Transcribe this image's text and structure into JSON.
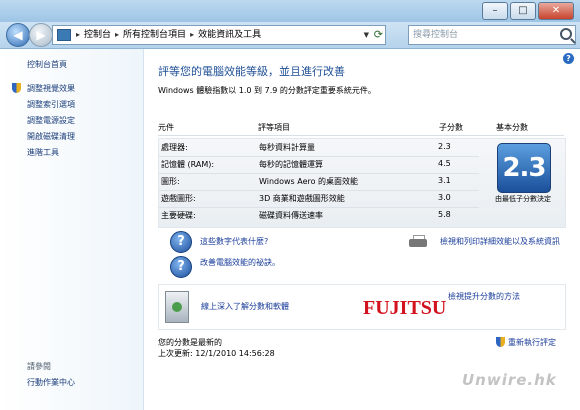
{
  "window": {
    "minimize_glyph": "–",
    "maximize_glyph": "□",
    "close_glyph": "✕"
  },
  "nav": {
    "back_glyph": "◀",
    "forward_glyph": "▶",
    "breadcrumbs": [
      "控制台",
      "所有控制台項目",
      "效能資訊及工具"
    ],
    "search_placeholder": "搜尋控制台"
  },
  "sidebar": {
    "home": "控制台首頁",
    "items": [
      "調整視覺效果",
      "調整索引選項",
      "調整電源設定",
      "開啟磁碟清理",
      "進階工具"
    ],
    "see_also_heading": "請參閱",
    "see_also": [
      "行動作業中心"
    ]
  },
  "main": {
    "title": "評等您的電腦效能等級，並且進行改善",
    "subtitle": "Windows 體驗指數以 1.0 到 7.9 的分數評定重要系統元件。",
    "columns": {
      "component": "元件",
      "rated_item": "評等項目",
      "subscore": "子分數",
      "base_score": "基本分數"
    },
    "rows": [
      {
        "component": "處理器:",
        "item": "每秒資料計算量",
        "score": "2.3"
      },
      {
        "component": "記憶體 (RAM):",
        "item": "每秒的記憶體運算",
        "score": "4.5"
      },
      {
        "component": "圖形:",
        "item": "Windows Aero 的桌面效能",
        "score": "3.1"
      },
      {
        "component": "遊戲圖形:",
        "item": "3D 商業和遊戲圖形效能",
        "score": "3.0"
      },
      {
        "component": "主要硬碟:",
        "item": "磁碟資料傳送速率",
        "score": "5.8"
      }
    ],
    "base_score_value": "2.3",
    "base_score_caption": "由最低子分數決定",
    "links": {
      "what_numbers_mean": "這些數字代表什麼?",
      "tips": "改善電腦效能的祕訣。",
      "print": "檢視和列印詳細效能以及系統資訊",
      "learn_more": "線上深入了解分數和軟體",
      "upgrade": "檢視提升分數的方法"
    },
    "promo_logo": "FUJITSU",
    "status": "您的分數是最新的",
    "last_update": "上次更新: 12/1/2010 14:56:28",
    "rerun": "重新執行評定",
    "watermark": "Unwire.hk"
  }
}
